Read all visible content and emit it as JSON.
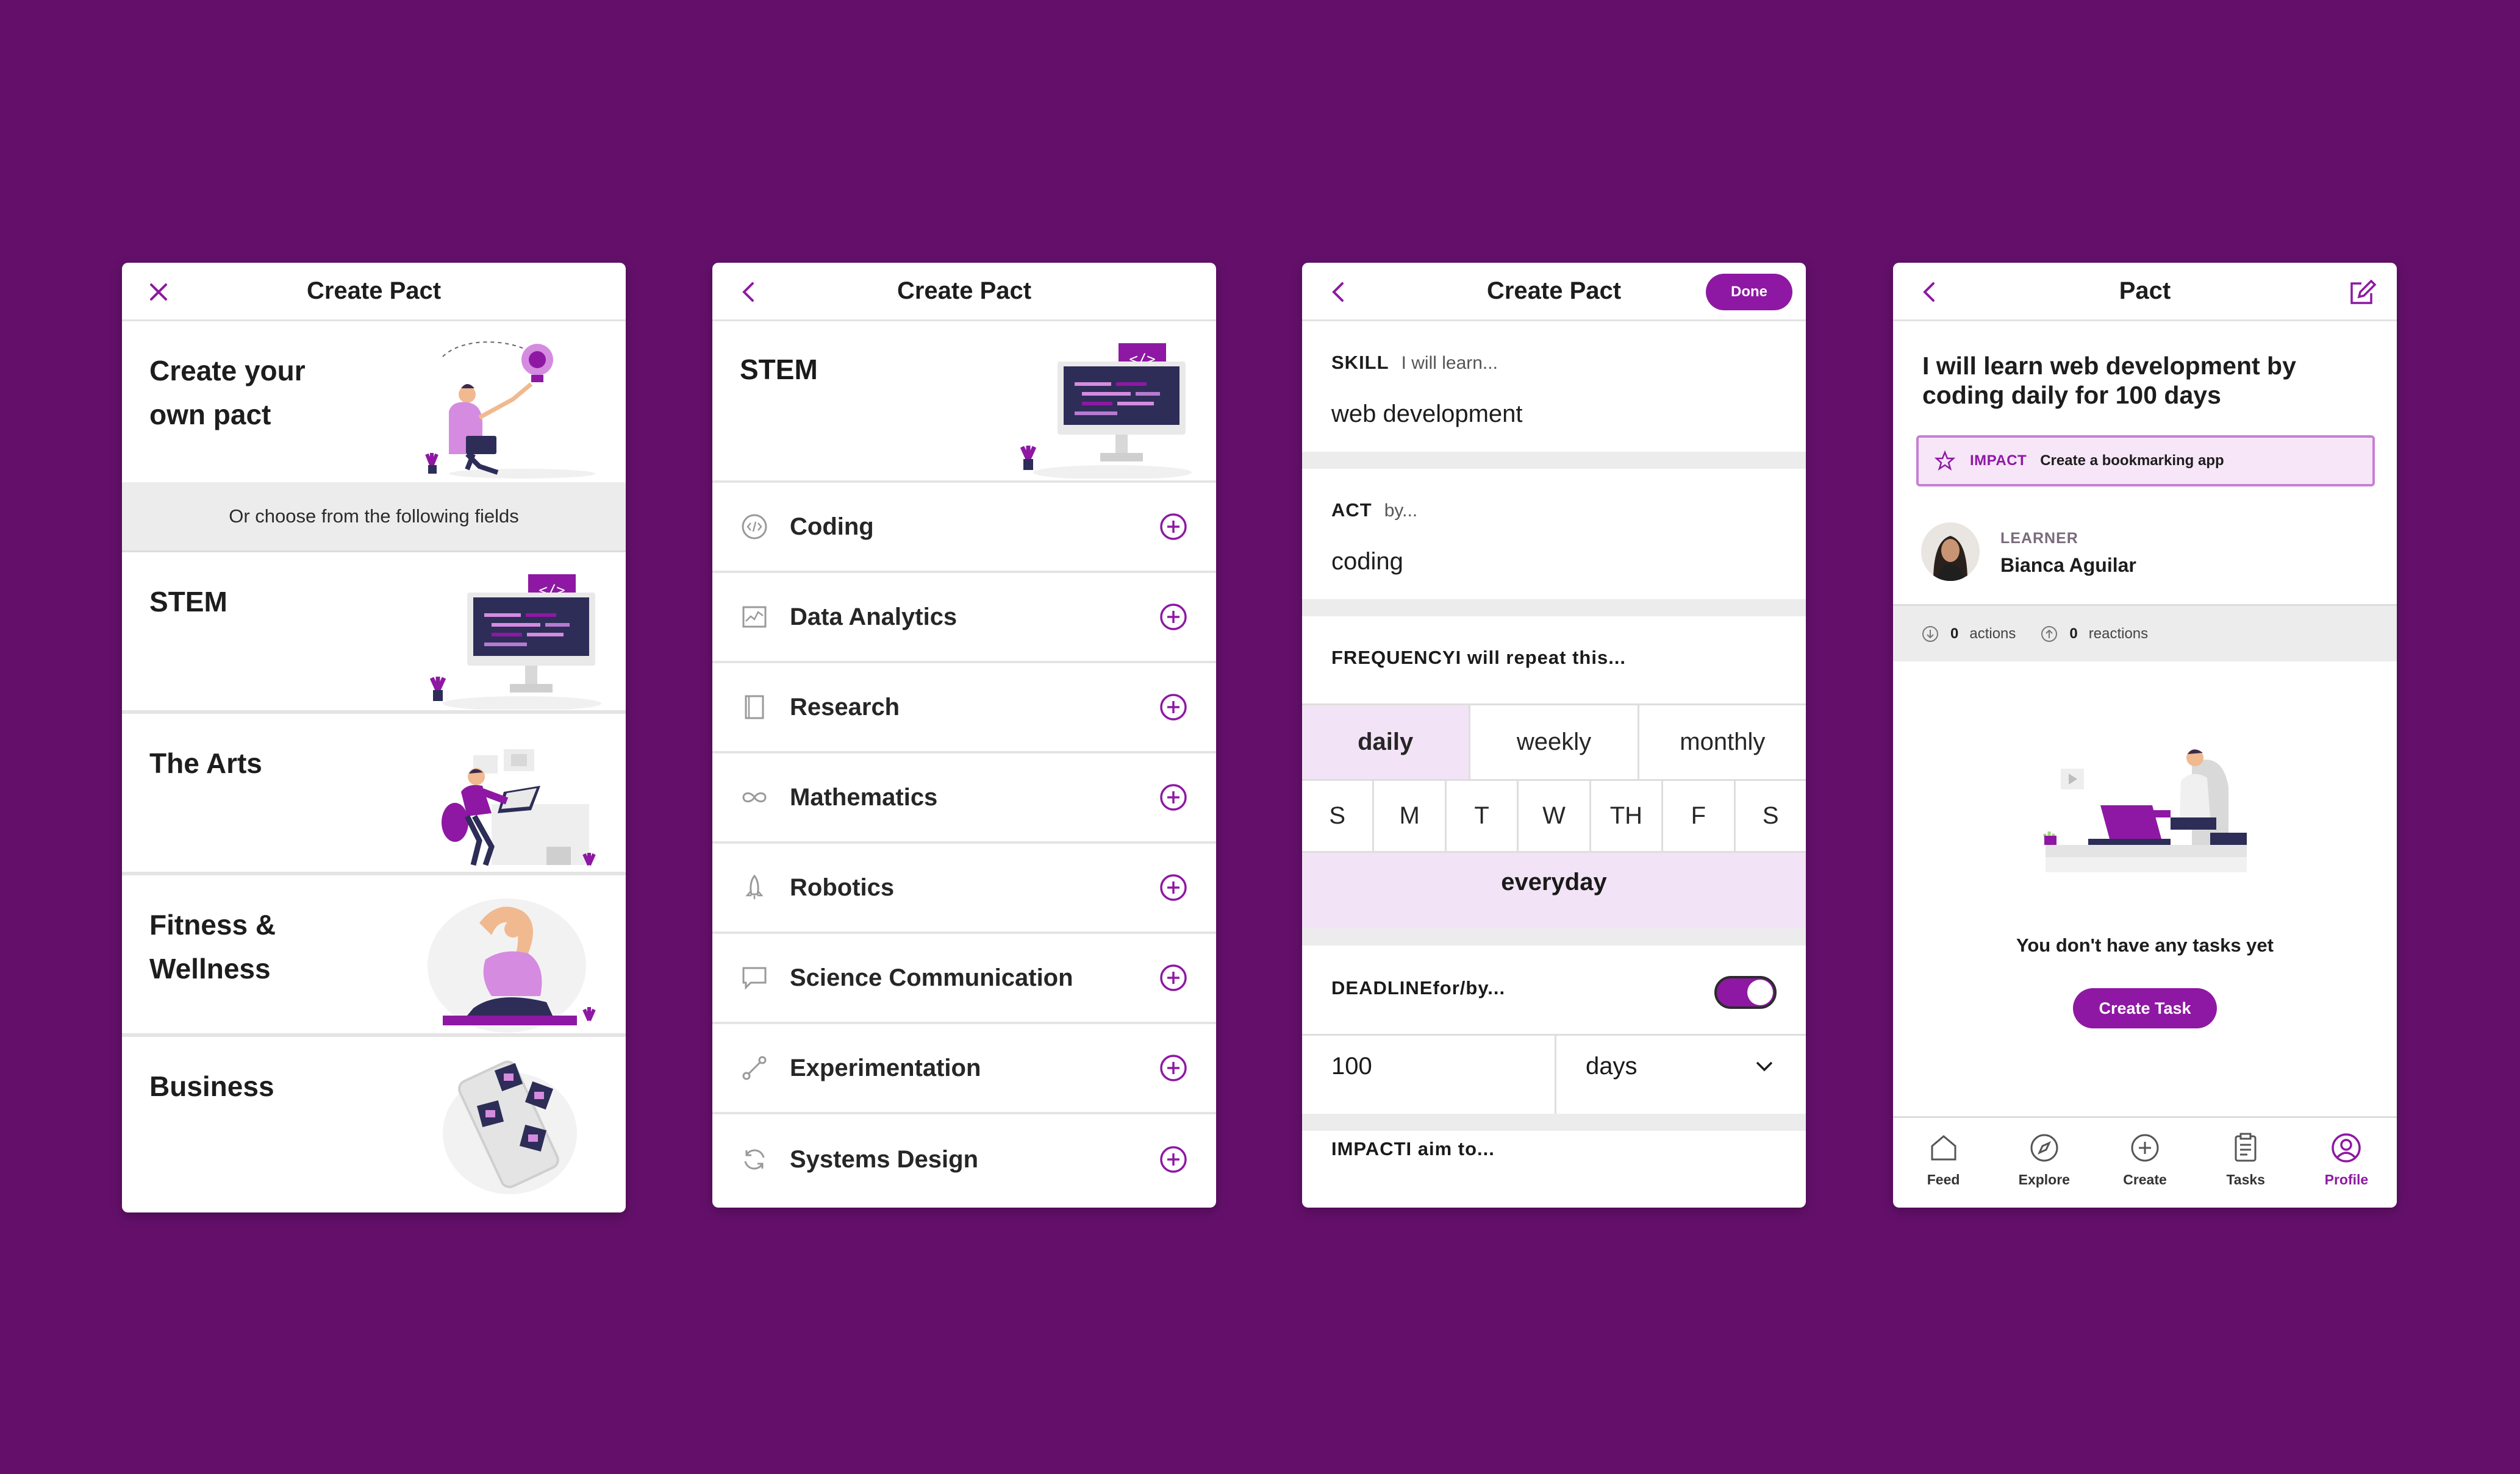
{
  "colors": {
    "background": "#64106b",
    "accent": "#8e18a3",
    "accent_light": "#f3e3f6",
    "divider": "#ececec"
  },
  "screen1": {
    "title": "Create Pact",
    "close_icon": "close-icon",
    "own_pact_label": "Create your own pact",
    "divider_text": "Or choose from the following fields",
    "fields": [
      {
        "label": "STEM",
        "illustration": "computer-code-illustration"
      },
      {
        "label": "The Arts",
        "illustration": "artist-desk-illustration"
      },
      {
        "label": "Fitness & Wellness",
        "illustration": "yoga-illustration"
      },
      {
        "label": "Business",
        "illustration": "phone-apps-illustration"
      }
    ]
  },
  "screen2": {
    "title": "Create Pact",
    "back_icon": "chevron-left-icon",
    "header_label": "STEM",
    "categories": [
      {
        "label": "Coding",
        "icon": "code-icon"
      },
      {
        "label": "Data Analytics",
        "icon": "chart-icon"
      },
      {
        "label": "Research",
        "icon": "book-icon"
      },
      {
        "label": "Mathematics",
        "icon": "infinity-icon"
      },
      {
        "label": "Robotics",
        "icon": "rocket-icon"
      },
      {
        "label": "Science Communication",
        "icon": "chat-bubble-icon"
      },
      {
        "label": "Experimentation",
        "icon": "nodes-icon"
      },
      {
        "label": "Systems Design",
        "icon": "refresh-icon"
      }
    ]
  },
  "screen3": {
    "title": "Create Pact",
    "done_label": "Done",
    "skill": {
      "key": "SKILL",
      "hint": "I will learn...",
      "value": "web development"
    },
    "act": {
      "key": "ACT",
      "hint": "by...",
      "value": "coding"
    },
    "frequency": {
      "key": "FREQUENCY",
      "hint": "I will repeat this...",
      "options": [
        "daily",
        "weekly",
        "monthly"
      ],
      "selected": "daily",
      "days": [
        "S",
        "M",
        "T",
        "W",
        "TH",
        "F",
        "S"
      ],
      "everyday_label": "everyday"
    },
    "deadline": {
      "key": "DEADLINE",
      "hint": "for/by...",
      "toggle_on": true,
      "amount": "100",
      "unit": "days"
    },
    "impact_key": "IMPACT",
    "impact_hint": "I aim to..."
  },
  "screen4": {
    "title": "Pact",
    "pact_title": "I will learn web development by coding daily for 100 days",
    "impact": {
      "key": "IMPACT",
      "value": "Create a bookmarking app"
    },
    "learner": {
      "role": "LEARNER",
      "name": "Bianca Aguilar"
    },
    "stats": {
      "actions_count": "0",
      "actions_label": "actions",
      "reactions_count": "0",
      "reactions_label": "reactions"
    },
    "empty_text": "You don't have any tasks yet",
    "create_task_label": "Create Task",
    "tabs": [
      {
        "label": "Feed",
        "icon": "home-icon"
      },
      {
        "label": "Explore",
        "icon": "compass-icon"
      },
      {
        "label": "Create",
        "icon": "plus-circle-icon"
      },
      {
        "label": "Tasks",
        "icon": "clipboard-icon"
      },
      {
        "label": "Profile",
        "icon": "user-circle-icon",
        "active": true
      }
    ]
  }
}
